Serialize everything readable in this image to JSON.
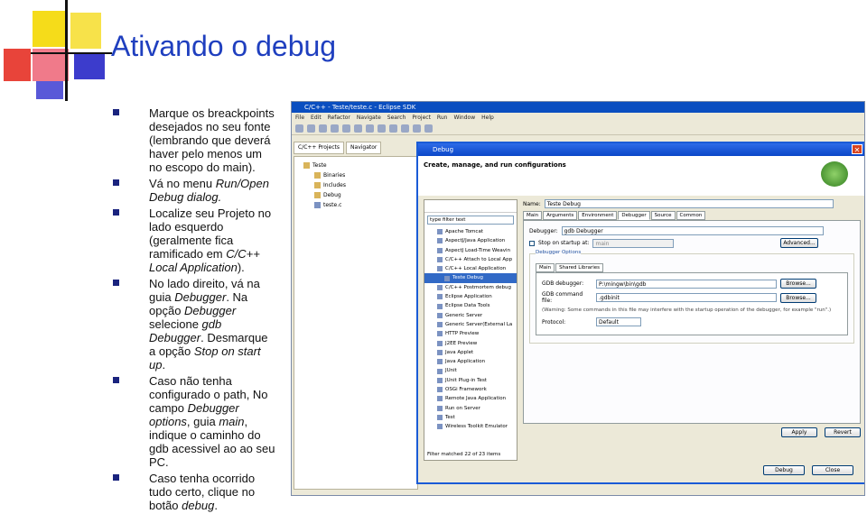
{
  "slide": {
    "title": "Ativando o debug",
    "bullets": [
      {
        "parts": [
          {
            "t": "Marque os breackpoints desejados no seu fonte (lembrando que deverá haver pelo menos um no escopo do main).",
            "i": false
          }
        ]
      },
      {
        "parts": [
          {
            "t": "Vá no menu ",
            "i": false
          },
          {
            "t": "Run/Open Debug dialog.",
            "i": true
          }
        ]
      },
      {
        "parts": [
          {
            "t": "Localize seu Projeto no lado esquerdo (geralmente fica ramificado em ",
            "i": false
          },
          {
            "t": "C/C++ Local Application",
            "i": true
          },
          {
            "t": ").",
            "i": false
          }
        ]
      },
      {
        "parts": [
          {
            "t": " No lado direito, vá na guia ",
            "i": false
          },
          {
            "t": "Debugger",
            "i": true
          },
          {
            "t": ". Na opção ",
            "i": false
          },
          {
            "t": "Debugger",
            "i": true
          },
          {
            "t": " selecione ",
            "i": false
          },
          {
            "t": "gdb Debugger",
            "i": true
          },
          {
            "t": ". Desmarque a opção ",
            "i": false
          },
          {
            "t": "Stop on start up",
            "i": true
          },
          {
            "t": ".",
            "i": false
          }
        ]
      },
      {
        "parts": [
          {
            "t": "Caso não tenha configurado o path, No campo ",
            "i": false
          },
          {
            "t": "Debugger options",
            "i": true
          },
          {
            "t": ", guia ",
            "i": false
          },
          {
            "t": "main",
            "i": true
          },
          {
            "t": ", indique o caminho do gdb acessivel ao ao seu PC.",
            "i": false
          }
        ]
      },
      {
        "parts": [
          {
            "t": "Caso tenha ocorrido tudo certo, clique no botão ",
            "i": false
          },
          {
            "t": "debug",
            "i": true
          },
          {
            "t": ".",
            "i": false
          }
        ]
      }
    ]
  },
  "eclipse": {
    "window_title": "C/C++ - Teste/teste.c - Eclipse SDK",
    "menu": [
      "File",
      "Edit",
      "Refactor",
      "Navigate",
      "Search",
      "Project",
      "Run",
      "Window",
      "Help"
    ],
    "view_tabs": [
      "C/C++ Projects",
      "Navigator"
    ],
    "tree": {
      "project": "Teste",
      "children": [
        "Binaries",
        "Includes",
        "Debug",
        "teste.c"
      ]
    },
    "dialog": {
      "title": "Debug",
      "heading": "Create, manage, and run configurations",
      "filter_placeholder": "type filter text",
      "configs": [
        "Apache Tomcat",
        "AspectJ/Java Application",
        "AspectJ Load-Time Weavin",
        "C/C++ Attach to Local App",
        "C/C++ Local Application",
        "Teste Debug",
        "C/C++ Postmortem debug",
        "Eclipse Application",
        "Eclipse Data Tools",
        "Generic Server",
        "Generic Server(External La",
        "HTTP Preview",
        "J2EE Preview",
        "Java Applet",
        "Java Application",
        "JUnit",
        "JUnit Plug-in Test",
        "OSGi Framework",
        "Remote Java Application",
        "Run on Server",
        "Test",
        "Wireless Toolkit Emulator"
      ],
      "selected_config": "Teste Debug",
      "filter_status": "Filter matched 22 of 23 items",
      "name_label": "Name:",
      "name_value": "Teste Debug",
      "tabs": [
        "Main",
        "Arguments",
        "Environment",
        "Debugger",
        "Source",
        "Common"
      ],
      "active_tab": "Debugger",
      "debugger_label": "Debugger:",
      "debugger_value": "gdb Debugger",
      "stop_label": "Stop on startup at:",
      "stop_value": "main",
      "advanced": "Advanced...",
      "options_group": "Debugger Options",
      "subtabs": [
        "Main",
        "Shared Libraries"
      ],
      "gdb_debugger_label": "GDB debugger:",
      "gdb_debugger_value": "P:\\mingw\\bin\\gdb",
      "gdb_command_label": "GDB command file:",
      "gdb_command_value": ".gdbinit",
      "browse": "Browse...",
      "warning": "(Warning: Some commands in this file may interfere with the startup operation of the debugger, for example \"run\".)",
      "protocol_label": "Protocol:",
      "protocol_value": "Default",
      "apply": "Apply",
      "revert": "Revert",
      "debug": "Debug",
      "close": "Close"
    }
  }
}
